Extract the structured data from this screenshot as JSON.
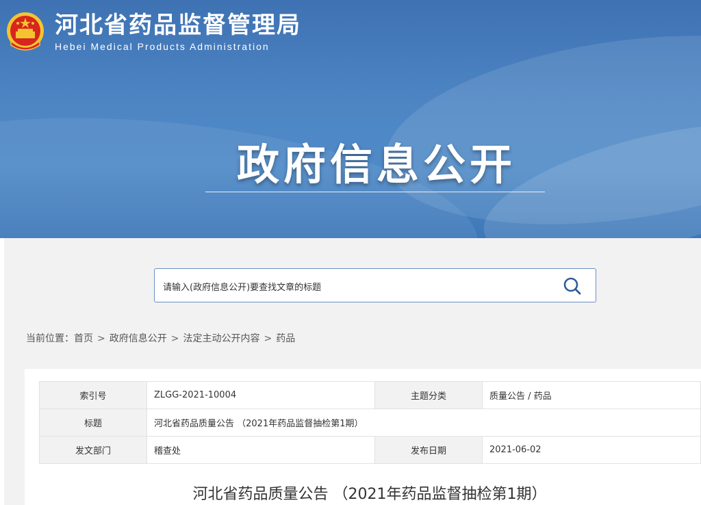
{
  "header": {
    "site_title": "河北省药品监督管理局",
    "site_subtitle": "Hebei Medical Products Administration"
  },
  "hero": {
    "title": "政府信息公开"
  },
  "search": {
    "placeholder": "请输入(政府信息公开)要查找文章的标题",
    "icon": "search-icon"
  },
  "breadcrumb": {
    "prefix": "当前位置：",
    "items": [
      "首页",
      "政府信息公开",
      "法定主动公开内容",
      "药品"
    ],
    "separator": ">"
  },
  "meta": {
    "index_label": "索引号",
    "index_value": "ZLGG-2021-10004",
    "topic_label": "主题分类",
    "topic_value": "质量公告 / 药品",
    "title_label": "标题",
    "title_value": "河北省药品质量公告 （2021年药品监督抽检第1期）",
    "dept_label": "发文部门",
    "dept_value": "稽查处",
    "date_label": "发布日期",
    "date_value": "2021-06-02"
  },
  "article": {
    "title": "河北省药品质量公告 （2021年药品监督抽检第1期）"
  },
  "colors": {
    "banner": "#4a82c2",
    "border": "#6a8fc2",
    "label_bg": "#f2f2f2",
    "emblem_red": "#d7261e",
    "emblem_gold": "#f4c430"
  }
}
